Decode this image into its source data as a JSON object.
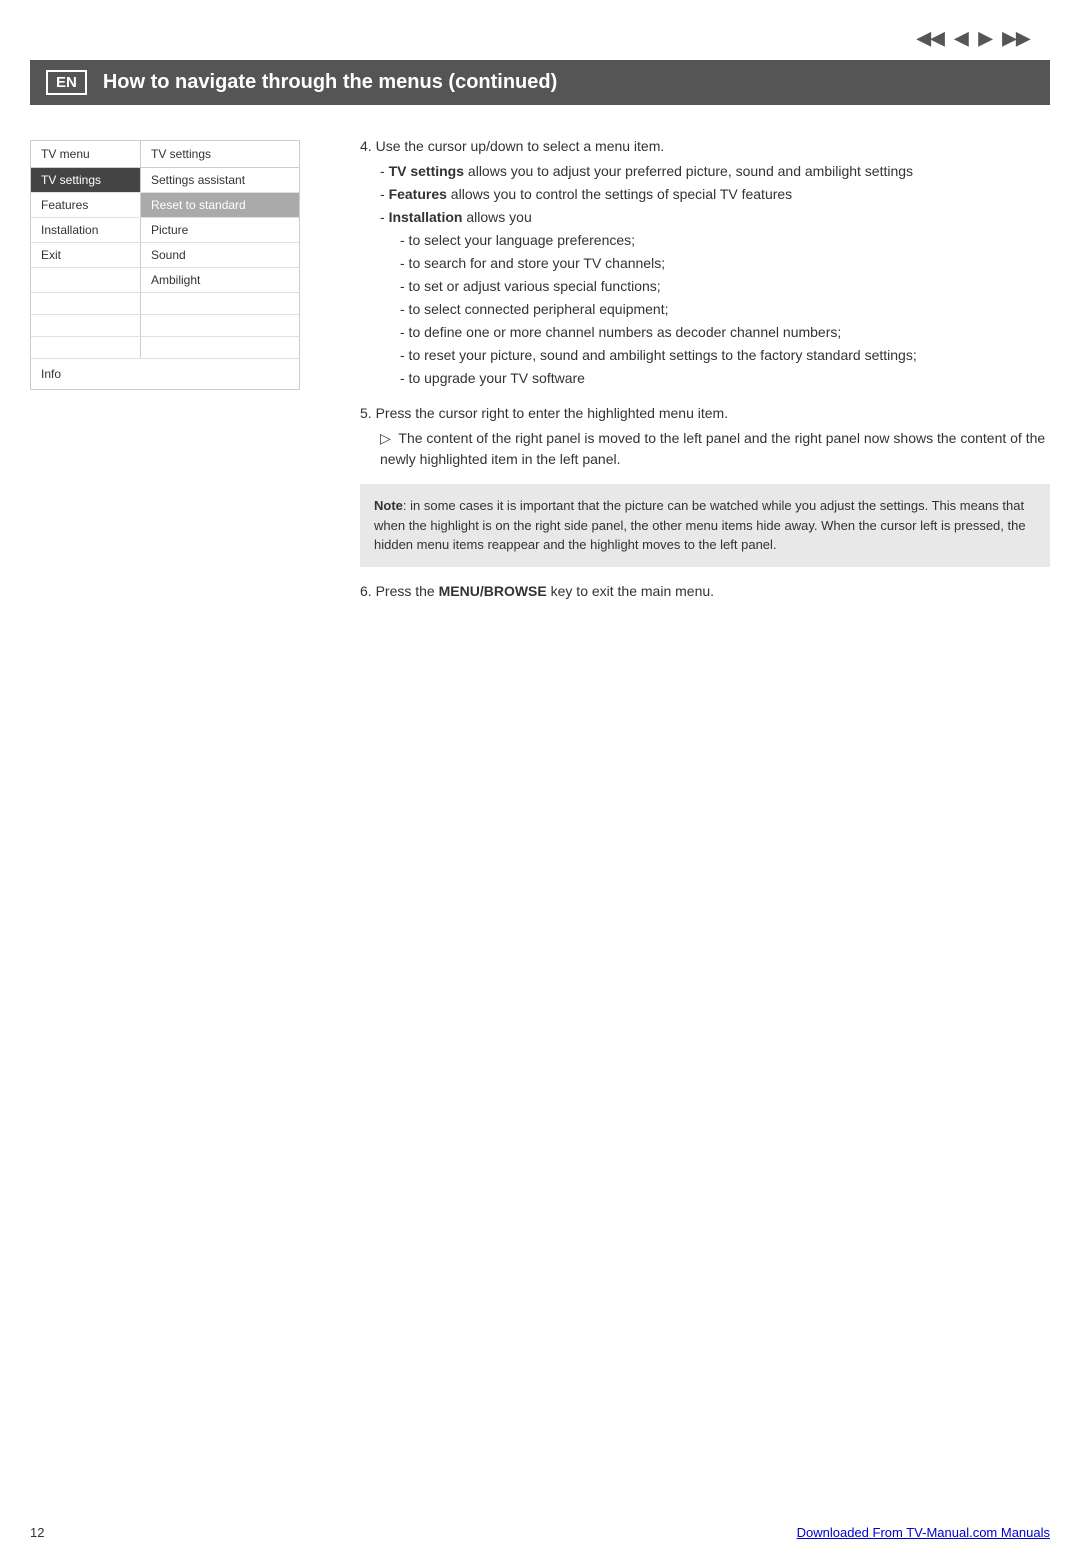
{
  "page": {
    "number": "12",
    "footer_link": "Downloaded From TV-Manual.com Manuals"
  },
  "header": {
    "lang_badge": "EN",
    "title": "How to navigate through the menus  (continued)"
  },
  "nav_arrows": [
    "◀◀",
    "◀",
    "▶",
    "▶▶"
  ],
  "tv_menu": {
    "col1_header": "TV menu",
    "col2_header": "TV settings",
    "rows": [
      {
        "col1": "TV settings",
        "col1_style": "selected",
        "col2": "Settings assistant",
        "col2_style": "normal"
      },
      {
        "col1": "Features",
        "col1_style": "normal",
        "col2": "Reset to standard",
        "col2_style": "highlighted-gray"
      },
      {
        "col1": "Installation",
        "col1_style": "normal",
        "col2": "Picture",
        "col2_style": "normal"
      },
      {
        "col1": "Exit",
        "col1_style": "normal",
        "col2": "Sound",
        "col2_style": "normal"
      },
      {
        "col1": "",
        "col1_style": "normal",
        "col2": "Ambilight",
        "col2_style": "normal"
      }
    ],
    "empty_rows": 3,
    "info_label": "Info"
  },
  "instructions": {
    "step4": {
      "number": "4.",
      "text": "Use the cursor up/down to select a menu item.",
      "sub_items": [
        {
          "label": "TV settings",
          "label_bold": true,
          "text": " allows you to adjust your preferred picture, sound and ambilight settings"
        },
        {
          "label": "Features",
          "label_bold": true,
          "text": " allows you to control the settings of special TV features"
        },
        {
          "label": "Installation",
          "label_bold": true,
          "text": " allows you"
        }
      ],
      "installation_items": [
        "to select your language preferences;",
        "to search for and store your TV channels;",
        "to set or adjust various special functions;",
        "to select connected peripheral equipment;",
        "to define one or more channel numbers as decoder channel numbers;",
        "to reset your picture, sound and ambilight settings to the factory standard settings;",
        "to upgrade your TV software"
      ]
    },
    "step5": {
      "number": "5.",
      "text": "Press the cursor right to enter the highlighted menu item.",
      "sub_item": "The content of the right panel is moved to the left panel and the right panel now shows the content of the newly highlighted item in the left panel."
    },
    "note": {
      "label": "Note",
      "text": ": in some cases it is important that the picture can be watched while you adjust the settings. This means that when the highlight is on the right side panel, the other menu items hide away. When the cursor left is pressed, the hidden menu items reappear and the highlight moves to the left panel."
    },
    "step6": {
      "number": "6.",
      "text": "Press the ",
      "bold_text": "MENU/BROWSE",
      "text2": " key to exit the main menu."
    }
  }
}
